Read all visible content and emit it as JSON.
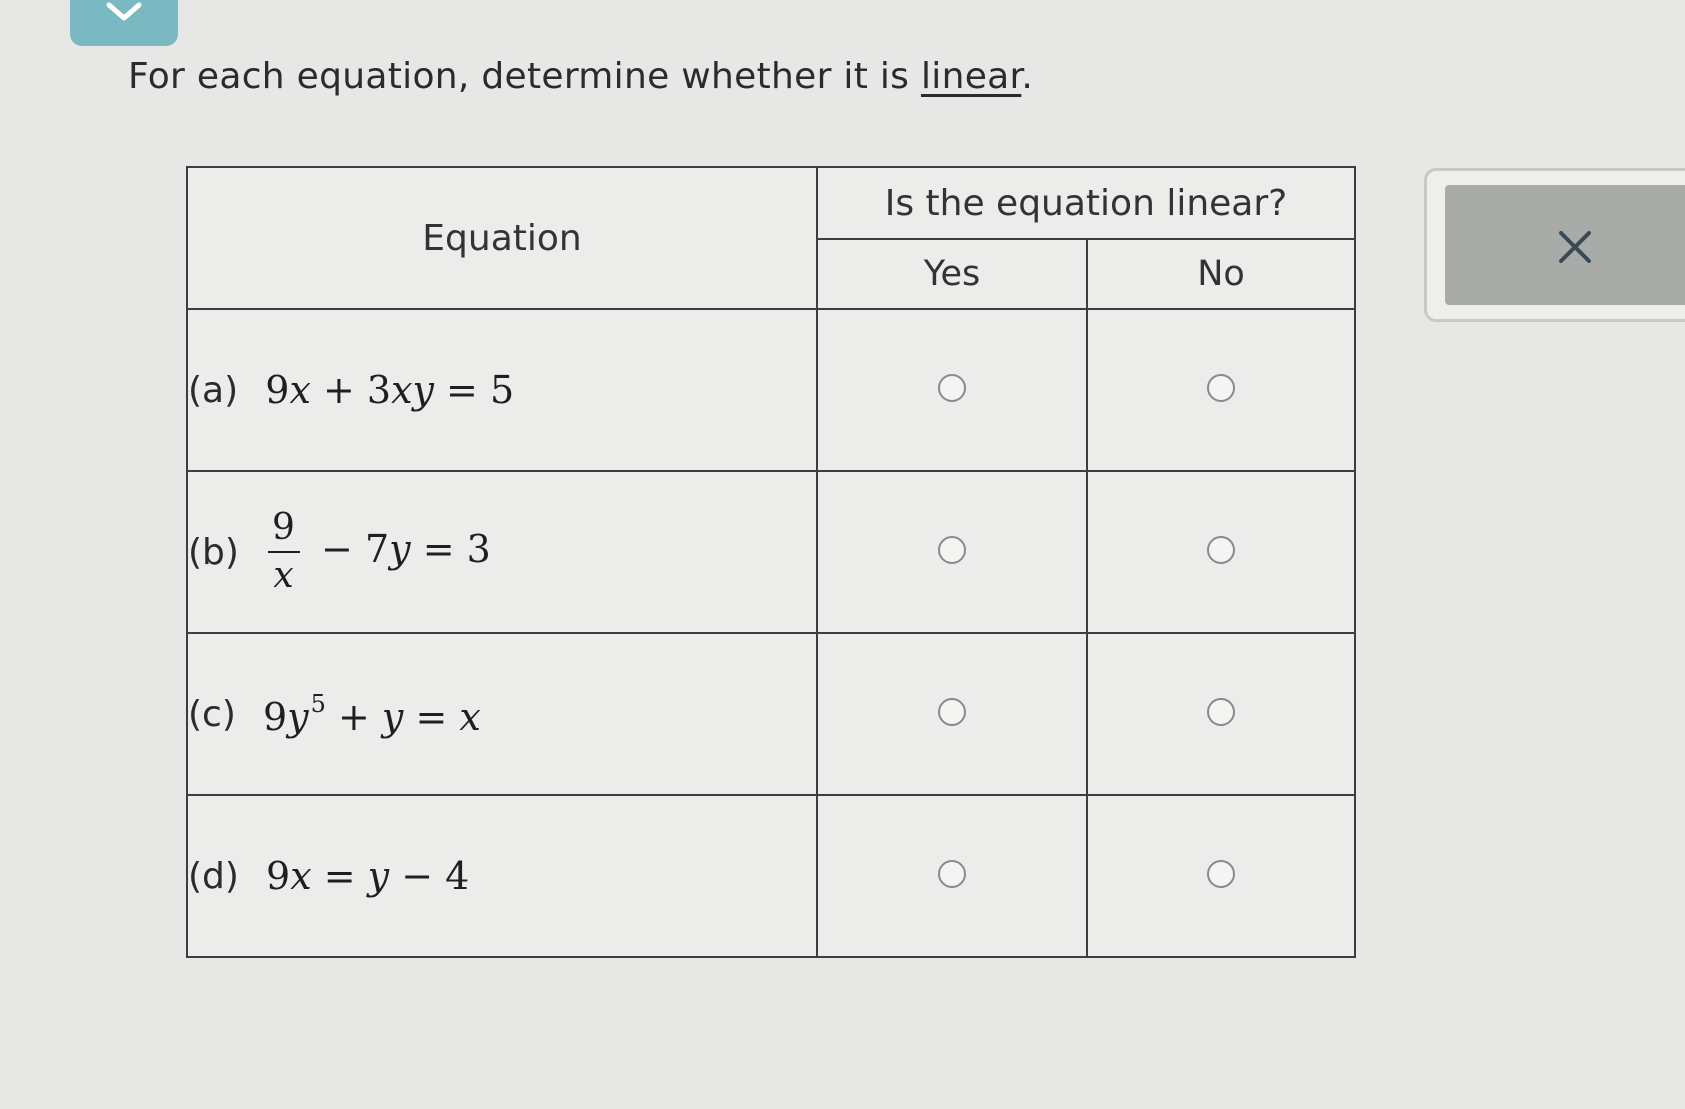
{
  "prompt": {
    "text_before": "For each equation, determine whether it is ",
    "link_text": "linear",
    "text_after": "."
  },
  "table": {
    "headers": {
      "equation": "Equation",
      "question": "Is the equation linear?",
      "yes": "Yes",
      "no": "No"
    },
    "rows": [
      {
        "label": "(a)"
      },
      {
        "label": "(b)"
      },
      {
        "label": "(c)"
      },
      {
        "label": "(d)"
      }
    ]
  },
  "icons": {
    "top_tab": "chevron-down-icon",
    "clear_button": "close-icon"
  },
  "colors": {
    "top_tab": "#7ab9c2",
    "clear_button": "#a9aba9",
    "background": "#e7e8e6"
  }
}
